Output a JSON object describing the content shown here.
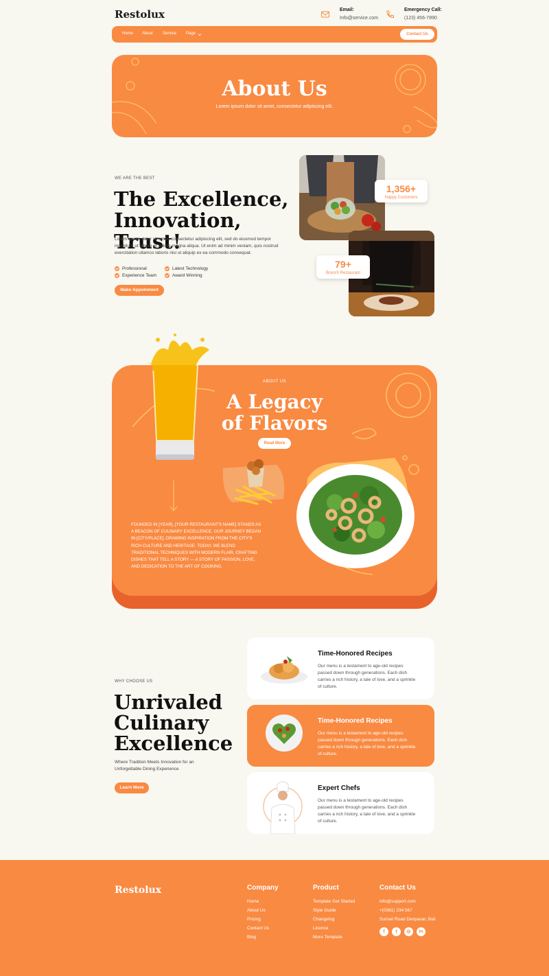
{
  "brand": {
    "name": "Restolux",
    "accent": "#f98a42",
    "accent_dark": "#e8622c",
    "background": "#f8f7f0"
  },
  "header": {
    "email_label": "Email:",
    "email_value": "Info@service.com",
    "phone_label": "Emergency Call:",
    "phone_value": "(123) 456-7890",
    "email_icon": "mail-icon",
    "phone_icon": "phone-icon"
  },
  "nav": {
    "items": [
      "Home",
      "About",
      "Service",
      "Page"
    ],
    "contact_label": "Contact Us"
  },
  "hero": {
    "title": "About Us",
    "subtitle": "Lorem ipsum dolor sit amet, consectetur adipiscing elit."
  },
  "excellence": {
    "eyebrow": "WE ARE THE BEST",
    "title": "The Excellence, Innovation, Trust!",
    "text": "Lorem ipsum dolor sit amet, consectetur adipiscing elit, sed do eiusmod tempor incididunt ut labore et dolore magna aliqua. Ut enim ad minim veniam, quis nostrud exercitation ullamco laboris nisi ut aliquip ex ea commodo consequat.",
    "features": [
      "Professional",
      "Latest Technology",
      "Experience Team",
      "Award Winning"
    ],
    "button_label": "Make Appoinment",
    "stats": [
      {
        "value": "1,356+",
        "label": "Happy Customers"
      },
      {
        "value": "79+",
        "label": "Branch Restaurant"
      }
    ]
  },
  "legacy": {
    "eyebrow": "ABOUT US",
    "title": "A Legacy of Flavors",
    "button_label": "Read More",
    "text": "Founded in [Year], [Your Restaurant's Name] stands as a beacon of culinary excellence. Our journey began in [City/Place], drawing inspiration from the city's rich culture and heritage. Today, we blend traditional techniques with modern flair, crafting dishes that tell a story — a story of passion, love, and dedication to the art of cooking."
  },
  "why": {
    "eyebrow": "WHY CHOOSE US",
    "title": "Unrivaled Culinary Excellence",
    "subtitle": "Where Tradition Meets Innovation for an Unforgettable Dining Experience",
    "button_label": "Learn More",
    "cards": [
      {
        "title": "Time-Honored Recipes",
        "text": "Our menu is a testament to age-old recipes passed down through generations. Each dish carries a rich history, a tale of love, and a sprinkle of culture.",
        "highlighted": false
      },
      {
        "title": "Time-Honored Recipes",
        "text": "Our menu is a testament to age-old recipes passed down through generations. Each dish carries a rich history, a tale of love, and a sprinkle of culture.",
        "highlighted": true
      },
      {
        "title": "Expert Chefs",
        "text": "Our menu is a testament to age-old recipes passed down through generations. Each dish carries a rich history, a tale of love, and a sprinkle of culture.",
        "highlighted": false
      }
    ]
  },
  "footer": {
    "logo": "Restolux",
    "company": {
      "title": "Company",
      "links": [
        "Home",
        "About Us",
        "Pricing",
        "Contact Us",
        "Blog"
      ]
    },
    "product": {
      "title": "Product",
      "links": [
        "Template Get Started",
        "Style Guide",
        "Changelog",
        "Licence",
        "More Template"
      ]
    },
    "contact": {
      "title": "Contact Us",
      "lines": [
        "info@support.com",
        "+(0361) 234 567",
        "Sunset Road Denpasar, Bali"
      ]
    },
    "social_icons": [
      "facebook-icon",
      "twitter-icon",
      "instagram-icon",
      "linkedin-icon"
    ],
    "social_glyphs": [
      "f",
      "t",
      "◎",
      "in"
    ]
  }
}
